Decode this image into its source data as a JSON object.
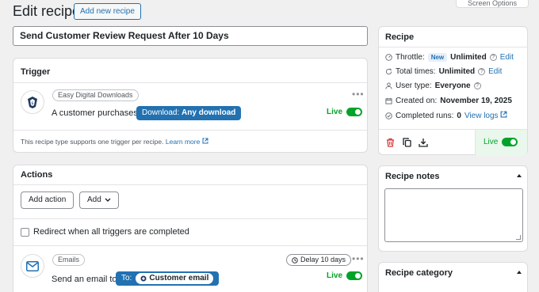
{
  "screen_options": {
    "label": "Screen Options"
  },
  "header": {
    "title": "Edit recipe",
    "add_new_label": "Add new recipe"
  },
  "recipe_title": "Send Customer Review Request After 10 Days",
  "trigger": {
    "heading": "Trigger",
    "integration": "Easy Digital Downloads",
    "sentence_prefix": "A customer purchases",
    "pill_label": "Download:",
    "pill_value": "Any download",
    "status": "Live",
    "note": "This recipe type supports one trigger per recipe.",
    "learn_more": "Learn more"
  },
  "actions": {
    "heading": "Actions",
    "add_action_label": "Add action",
    "add_label": "Add",
    "redirect_label": "Redirect when all triggers are completed",
    "action": {
      "integration": "Emails",
      "delay_label": "Delay 10 days",
      "sentence_prefix": "Send an email to",
      "pill_label": "To:",
      "pill_value": "Customer email",
      "status": "Live"
    }
  },
  "recipe_panel": {
    "heading": "Recipe",
    "throttle_label": "Throttle:",
    "throttle_badge": "New",
    "throttle_value": "Unlimited",
    "throttle_edit": "Edit",
    "total_label": "Total times:",
    "total_value": "Unlimited",
    "total_edit": "Edit",
    "user_type_label": "User type:",
    "user_type_value": "Everyone",
    "created_label": "Created on:",
    "created_value": "November 19, 2025",
    "completed_label": "Completed runs:",
    "completed_value": "0",
    "view_logs": "View logs",
    "status": "Live"
  },
  "notes_panel": {
    "heading": "Recipe notes"
  },
  "category_panel": {
    "heading": "Recipe category"
  },
  "colors": {
    "accent": "#2271b1",
    "live": "#00a32a",
    "delete": "#d63638"
  }
}
